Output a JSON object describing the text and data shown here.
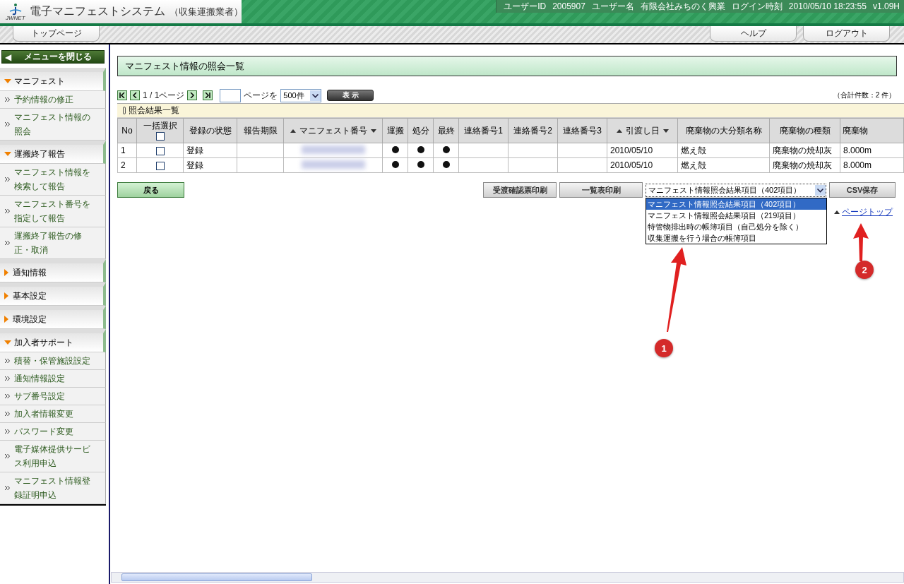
{
  "header": {
    "logo_caption": "JWNET",
    "title": "電子マニフェストシステム",
    "subtitle": "（収集運搬業者）",
    "user_info": [
      "ユーザーID",
      "2005907",
      "ユーザー名",
      "有限会社みちのく興業",
      "ログイン時刻",
      "2010/05/10 18:23:55",
      "v1.09H"
    ]
  },
  "nav_tabs_left": [
    "トップページ"
  ],
  "nav_tabs_right": [
    "ヘルプ",
    "ログアウト"
  ],
  "sidebar": {
    "close_button": {
      "icon": "◀",
      "label": "メニューを閉じる"
    },
    "sections": [
      {
        "title": "マニフェスト",
        "expanded": true,
        "items": [
          "予約情報の修正",
          "マニフェスト情報の照会"
        ]
      },
      {
        "title": "運搬終了報告",
        "expanded": true,
        "items": [
          "マニフェスト情報を検索して報告",
          "マニフェスト番号を指定して報告",
          "運搬終了報告の修正・取消"
        ]
      },
      {
        "title": "通知情報",
        "expanded": false
      },
      {
        "title": "基本設定",
        "expanded": false
      },
      {
        "title": "環境設定",
        "expanded": false
      },
      {
        "title": "加入者サポート",
        "expanded": true,
        "items": [
          "積替・保管施設設定",
          "通知情報設定",
          "サブ番号設定",
          "加入者情報変更",
          "パスワード変更",
          "電子媒体提供サービス利用申込",
          "マニフェスト情報登録証明申込"
        ]
      }
    ]
  },
  "page_title": "マニフェスト情報の照会一覧",
  "pager": {
    "page_info": "1 / 1ページ",
    "page_suffix": "ページを",
    "page_size": "500件",
    "show_button": "表 示",
    "total": "（合計件数：2 件）"
  },
  "results": {
    "title": "照会結果一覧",
    "select_all_checked": false,
    "columns": [
      {
        "label": "No",
        "sortable": false
      },
      {
        "label": "一括選択",
        "sortable": false,
        "kind": "checkbox"
      },
      {
        "label": "登録の状態",
        "sortable": false
      },
      {
        "label": "報告期限",
        "sortable": false
      },
      {
        "label": "マニフェスト番号",
        "sortable": true
      },
      {
        "label": "運搬",
        "sortable": false
      },
      {
        "label": "処分",
        "sortable": false
      },
      {
        "label": "最終",
        "sortable": false
      },
      {
        "label": "連絡番号1",
        "sortable": false
      },
      {
        "label": "連絡番号2",
        "sortable": false
      },
      {
        "label": "連絡番号3",
        "sortable": false
      },
      {
        "label": "引渡し日",
        "sortable": true
      },
      {
        "label": "廃棄物の大分類名称",
        "sortable": false
      },
      {
        "label": "廃棄物の種類",
        "sortable": false
      },
      {
        "label": "廃棄物",
        "sortable": false
      }
    ],
    "rows": [
      {
        "no": "1",
        "checked": false,
        "status": "登録",
        "transport": true,
        "disposal": true,
        "final": true,
        "date": "2010/05/10",
        "category": "燃え殻",
        "type": "廃棄物の焼却灰",
        "quantity": "8.000m"
      },
      {
        "no": "2",
        "checked": false,
        "status": "登録",
        "transport": true,
        "disposal": true,
        "final": true,
        "date": "2010/05/10",
        "category": "燃え殻",
        "type": "廃棄物の焼却灰",
        "quantity": "8.000m"
      }
    ]
  },
  "actions": {
    "back": "戻る",
    "print_receipt": "受渡確認票印刷",
    "print_list": "一覧表印刷",
    "csv_select": {
      "value": "マニフェスト情報照会結果項目（402項目）",
      "expanded": true,
      "options": [
        {
          "label": "マニフェスト情報照会結果項目（402項目）",
          "selected": true
        },
        {
          "label": "マニフェスト情報照会結果項目（219項目）",
          "selected": false
        },
        {
          "label": "特管物排出時の帳簿項目（自己処分を除く）",
          "selected": false
        },
        {
          "label": "収集運搬を行う場合の帳簿項目",
          "selected": false
        }
      ]
    },
    "csv_save": "CSV保存",
    "page_top": "ページトップ"
  },
  "callouts": [
    {
      "number": "1"
    },
    {
      "number": "2"
    }
  ]
}
